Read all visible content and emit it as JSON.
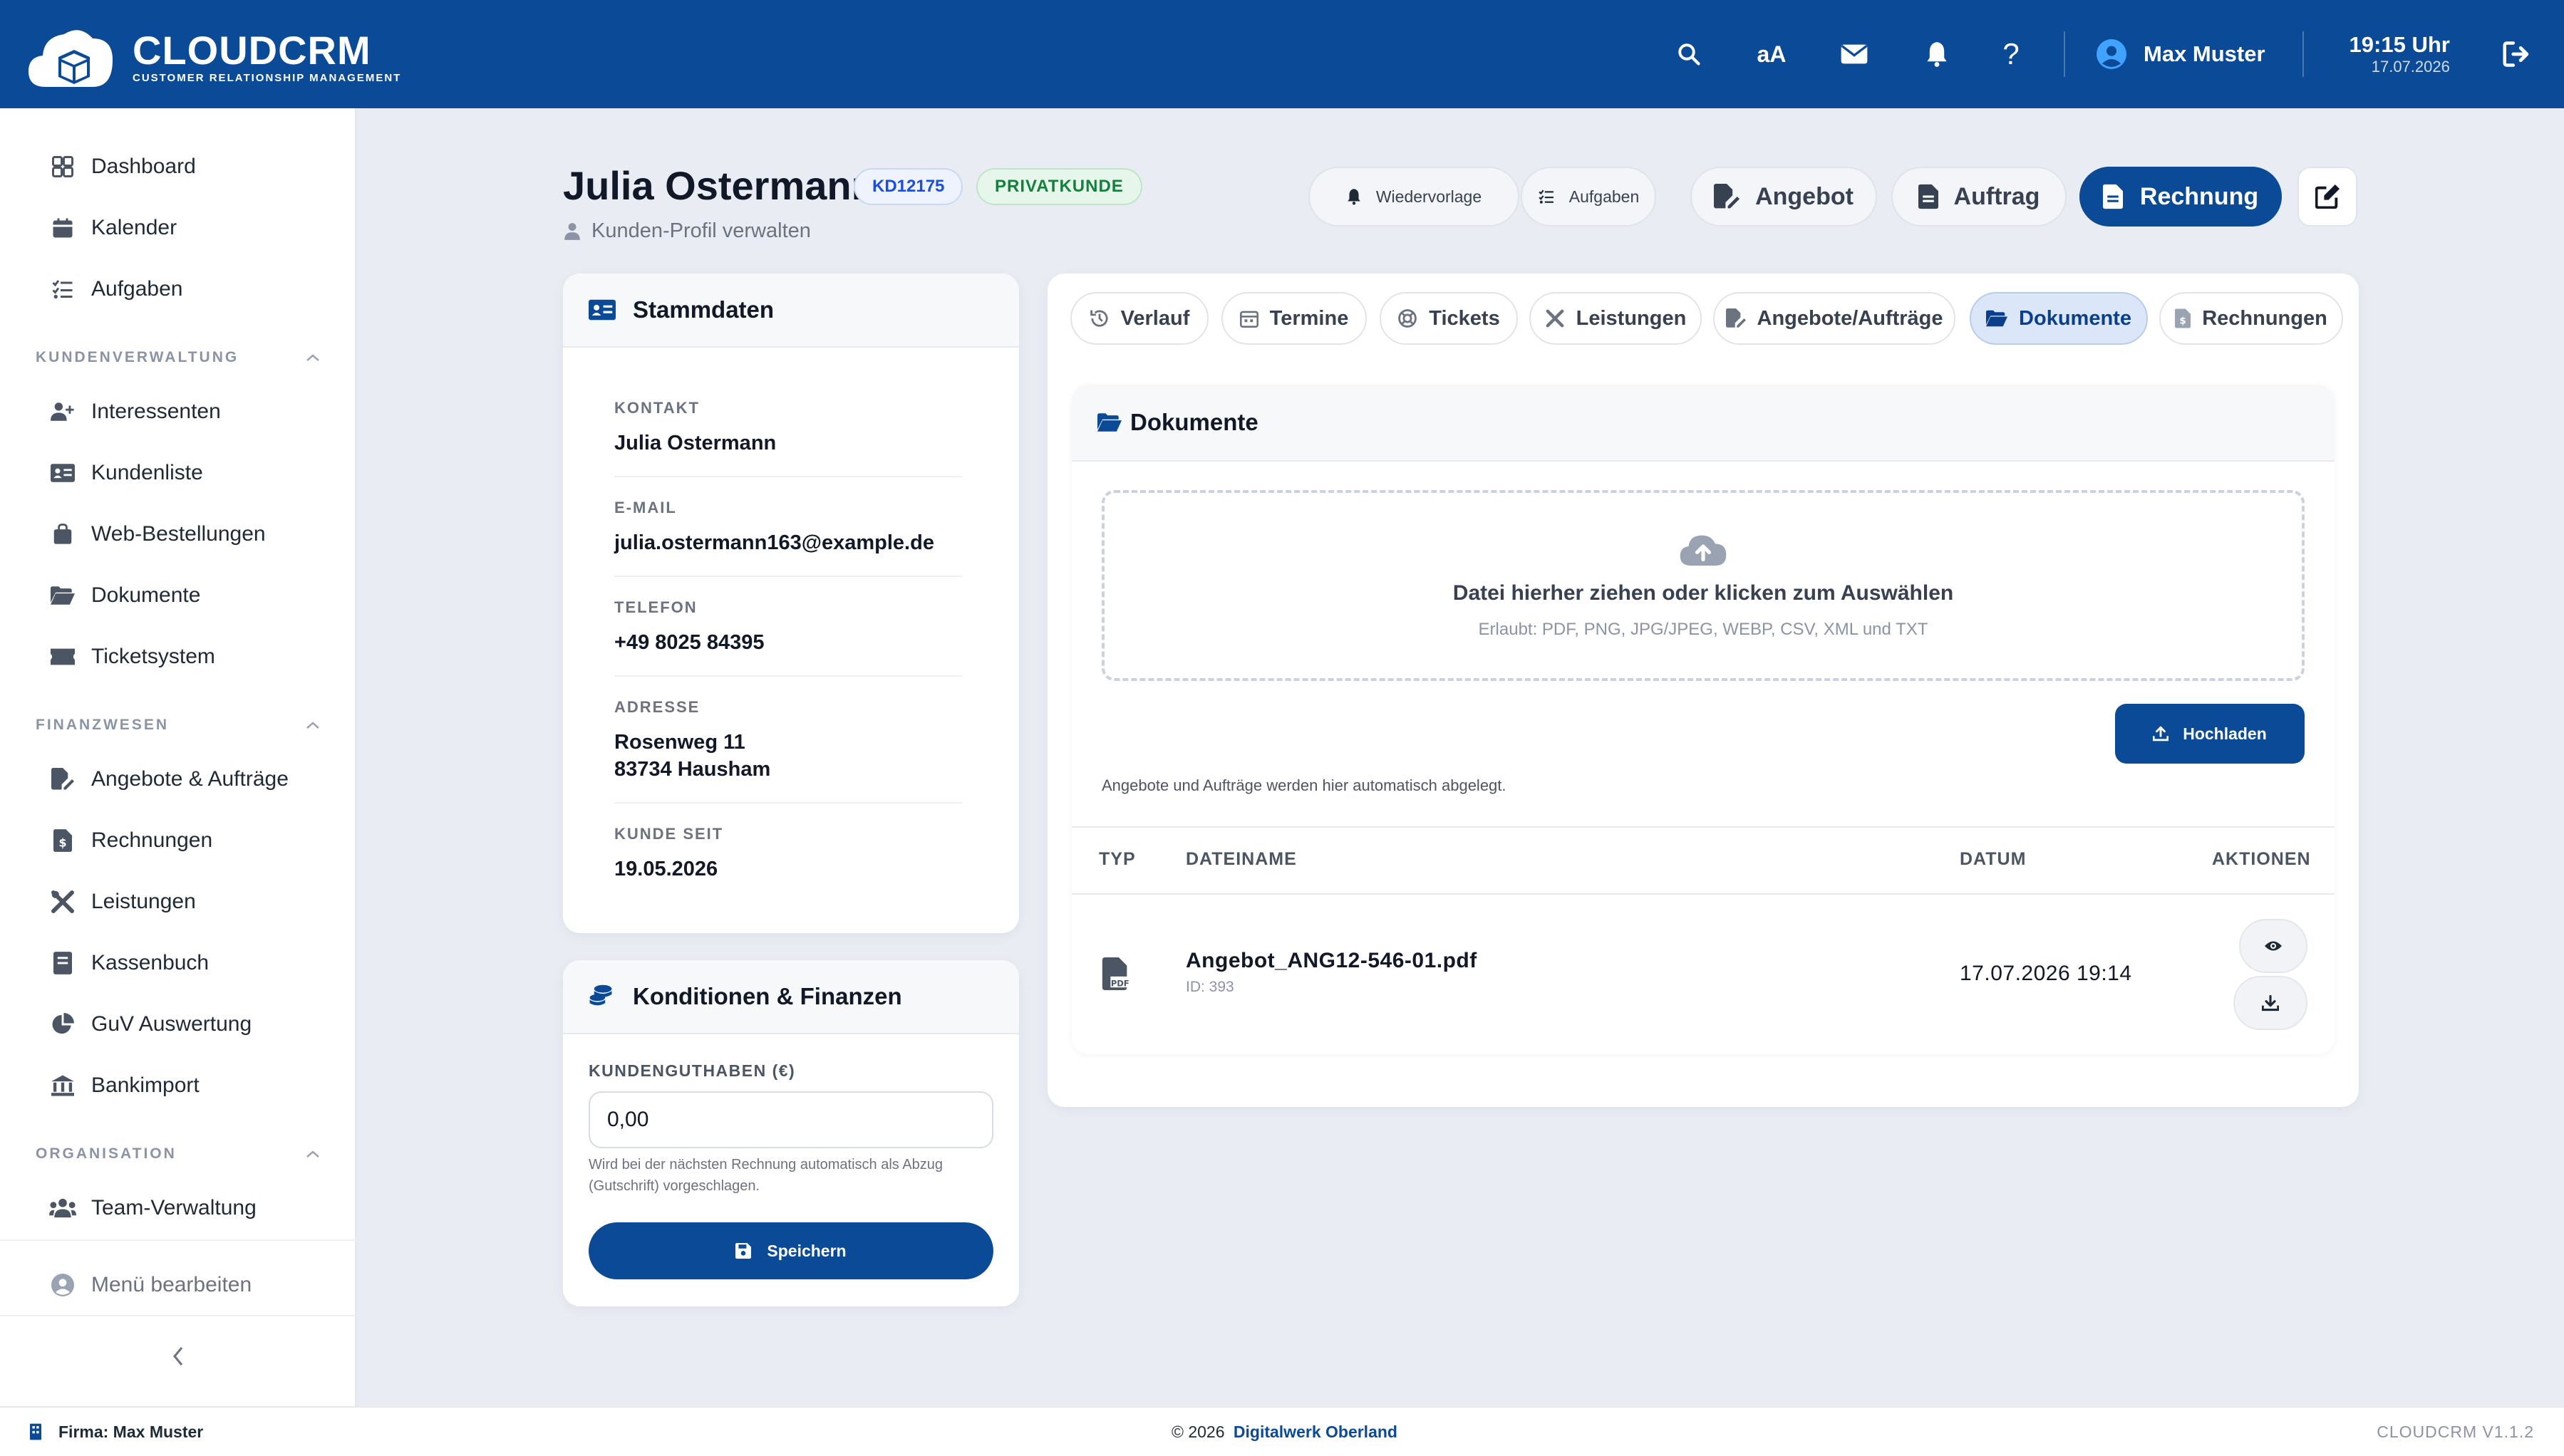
{
  "header": {
    "logo_title": "CLOUDCRM",
    "logo_subtitle": "CUSTOMER RELATIONSHIP MANAGEMENT",
    "font_toggle": "aA",
    "user_name": "Max Muster",
    "time": "19:15 Uhr",
    "date": "17.07.2026"
  },
  "sidebar": {
    "items_top": [
      "Dashboard",
      "Kalender",
      "Aufgaben"
    ],
    "section1": "KUNDENVERWALTUNG",
    "items_kunden": [
      "Interessenten",
      "Kundenliste",
      "Web-Bestellungen",
      "Dokumente",
      "Ticketsystem"
    ],
    "section2": "FINANZWESEN",
    "items_finanz": [
      "Angebote & Aufträge",
      "Rechnungen",
      "Leistungen",
      "Kassenbuch",
      "GuV Auswertung",
      "Bankimport"
    ],
    "section3": "ORGANISATION",
    "items_org": [
      "Team-Verwaltung"
    ],
    "edit_menu": "Menü bearbeiten"
  },
  "customer": {
    "name": "Julia Ostermann",
    "id_badge": "KD12175",
    "type_badge": "PRIVATKUNDE",
    "subtitle": "Kunden-Profil verwalten"
  },
  "actions": {
    "wiedervorlage": "Wiedervorlage",
    "aufgaben": "Aufgaben",
    "angebot": "Angebot",
    "auftrag": "Auftrag",
    "rechnung": "Rechnung"
  },
  "stammdaten": {
    "title": "Stammdaten",
    "kontakt_label": "KONTAKT",
    "kontakt": "Julia Ostermann",
    "email_label": "E-MAIL",
    "email": "julia.ostermann163@example.de",
    "telefon_label": "TELEFON",
    "telefon": "+49 8025 84395",
    "adresse_label": "ADRESSE",
    "adresse_line1": "Rosenweg 11",
    "adresse_line2": "83734 Hausham",
    "kunde_seit_label": "KUNDE SEIT",
    "kunde_seit": "19.05.2026"
  },
  "konditionen": {
    "title": "Konditionen & Finanzen",
    "guthaben_label": "KUNDENGUTHABEN (€)",
    "guthaben_value": "0,00",
    "hint": "Wird bei der nächsten Rechnung automatisch als Abzug (Gutschrift) vorgeschlagen.",
    "save": "Speichern"
  },
  "tabs": [
    "Verlauf",
    "Termine",
    "Tickets",
    "Leistungen",
    "Angebote/Aufträge",
    "Dokumente",
    "Rechnungen"
  ],
  "active_tab": "Dokumente",
  "documents": {
    "title": "Dokumente",
    "drop_title": "Datei hierher ziehen oder klicken zum Auswählen",
    "drop_hint": "Erlaubt: PDF, PNG, JPG/JPEG, WEBP, CSV, XML und TXT",
    "upload": "Hochladen",
    "auto_note": "Angebote und Aufträge werden hier automatisch abgelegt.",
    "columns": [
      "TYP",
      "DATEINAME",
      "DATUM",
      "AKTIONEN"
    ],
    "rows": [
      {
        "type_icon": "pdf-file-icon",
        "filename": "Angebot_ANG12-546-01.pdf",
        "id": "ID: 393",
        "date": "17.07.2026 19:14"
      }
    ]
  },
  "footer": {
    "firma": "Firma: Max Muster",
    "copyright": "© 2026",
    "company": "Digitalwerk Oberland",
    "version": "CLOUDCRM V1.1.2"
  },
  "colors": {
    "primary": "#0b4a96",
    "background": "#e9edf3",
    "badge_green": "#15803d"
  }
}
